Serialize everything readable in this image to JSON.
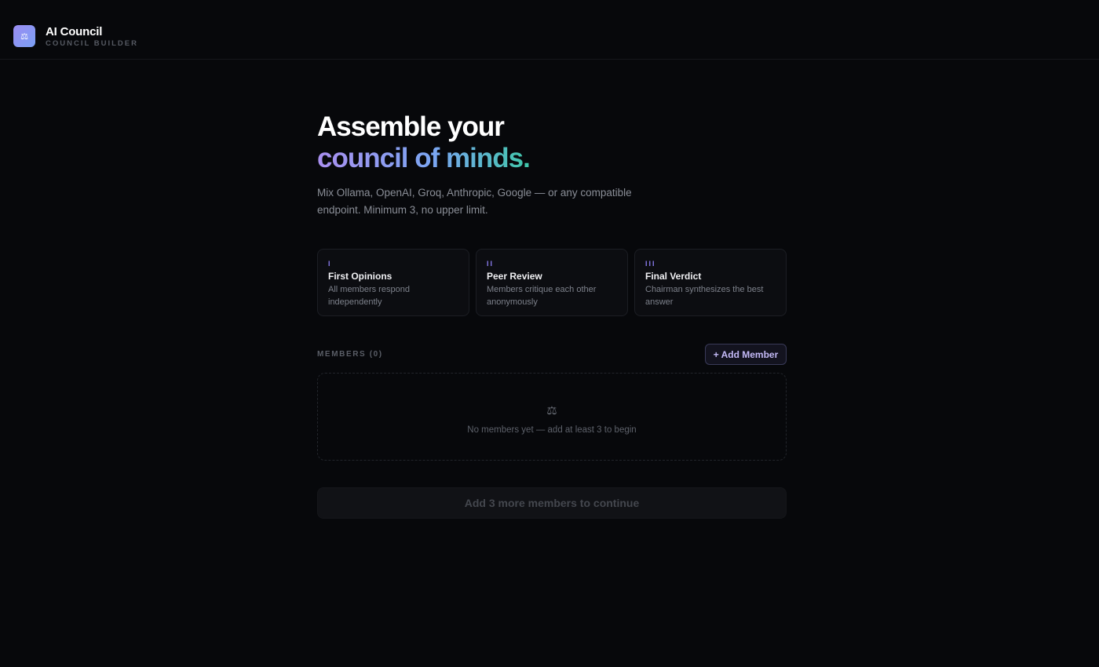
{
  "header": {
    "logo_icon": "scales-icon",
    "logo_glyph": "⚖",
    "title": "AI Council",
    "subtitle": "COUNCIL BUILDER"
  },
  "hero": {
    "title_line1": "Assemble your",
    "title_line2": "council of minds.",
    "description": "Mix Ollama, OpenAI, Groq, Anthropic, Google — or any compatible endpoint. Minimum 3, no upper limit."
  },
  "steps": [
    {
      "numeral": "I",
      "title": "First Opinions",
      "description": "All members respond independently"
    },
    {
      "numeral": "II",
      "title": "Peer Review",
      "description": "Members critique each other anonymously"
    },
    {
      "numeral": "III",
      "title": "Final Verdict",
      "description": "Chairman synthesizes the best answer"
    }
  ],
  "members": {
    "label": "MEMBERS (0)",
    "add_button": "+ Add Member",
    "empty_icon": "⚖",
    "empty_text": "No members yet — add at least 3 to begin"
  },
  "continue_button": "Add 3 more members to continue",
  "colors": {
    "background": "#07080b",
    "accent": "#8b7cf0",
    "gradient_start": "#a98ff0",
    "gradient_end": "#3fc7a9"
  }
}
